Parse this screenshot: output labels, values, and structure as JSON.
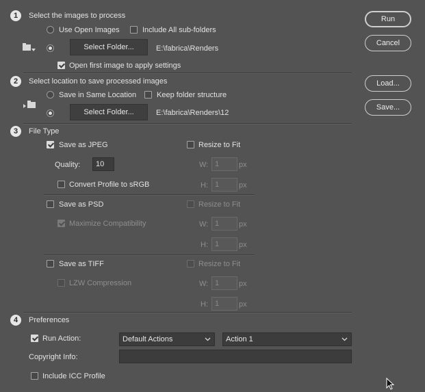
{
  "actions": {
    "run": "Run",
    "cancel": "Cancel",
    "load": "Load...",
    "save": "Save..."
  },
  "section1": {
    "number": "1",
    "title": "Select the images to process",
    "use_open_images": "Use Open Images",
    "include_subfolders": "Include All sub-folders",
    "select_folder": "Select Folder...",
    "folder_path": "E:\\fabrica\\Renders",
    "open_first_image": "Open first image to apply settings",
    "icon": "folder-in-icon"
  },
  "section2": {
    "number": "2",
    "title": "Select location to save processed images",
    "save_same_location": "Save in Same Location",
    "keep_folder_structure": "Keep folder structure",
    "select_folder": "Select Folder...",
    "folder_path": "E:\\fabrica\\Renders\\12",
    "icon": "folder-out-icon"
  },
  "section3": {
    "number": "3",
    "title": "File Type",
    "jpeg": {
      "label": "Save as JPEG",
      "checked": true,
      "resize": "Resize to Fit",
      "quality_label": "Quality:",
      "quality_value": "10",
      "convert_profile": "Convert Profile to sRGB",
      "w_label": "W:",
      "w_value": "1",
      "h_label": "H:",
      "h_value": "1",
      "unit": "px"
    },
    "psd": {
      "label": "Save as PSD",
      "resize": "Resize to Fit",
      "maximize": "Maximize Compatibility",
      "w_label": "W:",
      "w_value": "1",
      "h_label": "H:",
      "h_value": "1",
      "unit": "px"
    },
    "tiff": {
      "label": "Save as TIFF",
      "resize": "Resize to Fit",
      "lzw": "LZW Compression",
      "w_label": "W:",
      "w_value": "1",
      "h_label": "H:",
      "h_value": "1",
      "unit": "px"
    }
  },
  "section4": {
    "number": "4",
    "title": "Preferences",
    "run_action": "Run Action:",
    "action_set": "Default Actions",
    "action": "Action 1",
    "copyright_label": "Copyright Info:",
    "copyright_value": "",
    "include_icc": "Include ICC Profile"
  },
  "colors": {
    "background": "#535353",
    "field": "#3c3c3c",
    "text": "#e3e3e3",
    "disabled_text": "#8e8e8e"
  }
}
